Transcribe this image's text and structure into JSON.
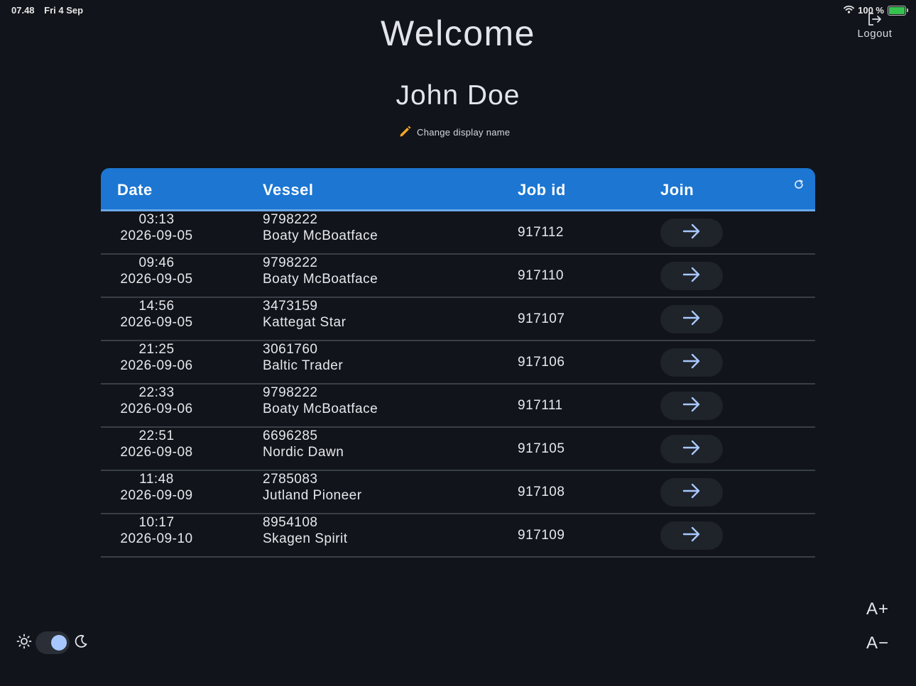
{
  "status_bar": {
    "time": "07.48",
    "date": "Fri 4 Sep",
    "battery": "100 %"
  },
  "header": {
    "welcome": "Welcome",
    "user_name": "John Doe",
    "change_name_label": "Change display name",
    "logout_label": "Logout"
  },
  "table": {
    "columns": {
      "date": "Date",
      "vessel": "Vessel",
      "job_id": "Job id",
      "join": "Join"
    },
    "rows": [
      {
        "time": "03:13",
        "date": "2026-09-05",
        "imo": "9798222",
        "vessel": "Boaty McBoatface",
        "job_id": "917112"
      },
      {
        "time": "09:46",
        "date": "2026-09-05",
        "imo": "9798222",
        "vessel": "Boaty McBoatface",
        "job_id": "917110"
      },
      {
        "time": "14:56",
        "date": "2026-09-05",
        "imo": "3473159",
        "vessel": "Kattegat Star",
        "job_id": "917107"
      },
      {
        "time": "21:25",
        "date": "2026-09-06",
        "imo": "3061760",
        "vessel": "Baltic Trader",
        "job_id": "917106"
      },
      {
        "time": "22:33",
        "date": "2026-09-06",
        "imo": "9798222",
        "vessel": "Boaty McBoatface",
        "job_id": "917111"
      },
      {
        "time": "22:51",
        "date": "2026-09-08",
        "imo": "6696285",
        "vessel": "Nordic Dawn",
        "job_id": "917105"
      },
      {
        "time": "11:48",
        "date": "2026-09-09",
        "imo": "2785083",
        "vessel": "Jutland Pioneer",
        "job_id": "917108"
      },
      {
        "time": "10:17",
        "date": "2026-09-10",
        "imo": "8954108",
        "vessel": "Skagen Spirit",
        "job_id": "917109"
      }
    ]
  },
  "controls": {
    "font_increase": "A+",
    "font_decrease": "A−",
    "theme": "dark"
  },
  "colors": {
    "background": "#11141a",
    "header_blue": "#1c76d2",
    "accent": "#a7c8ff",
    "edit_icon": "#f5a623"
  }
}
